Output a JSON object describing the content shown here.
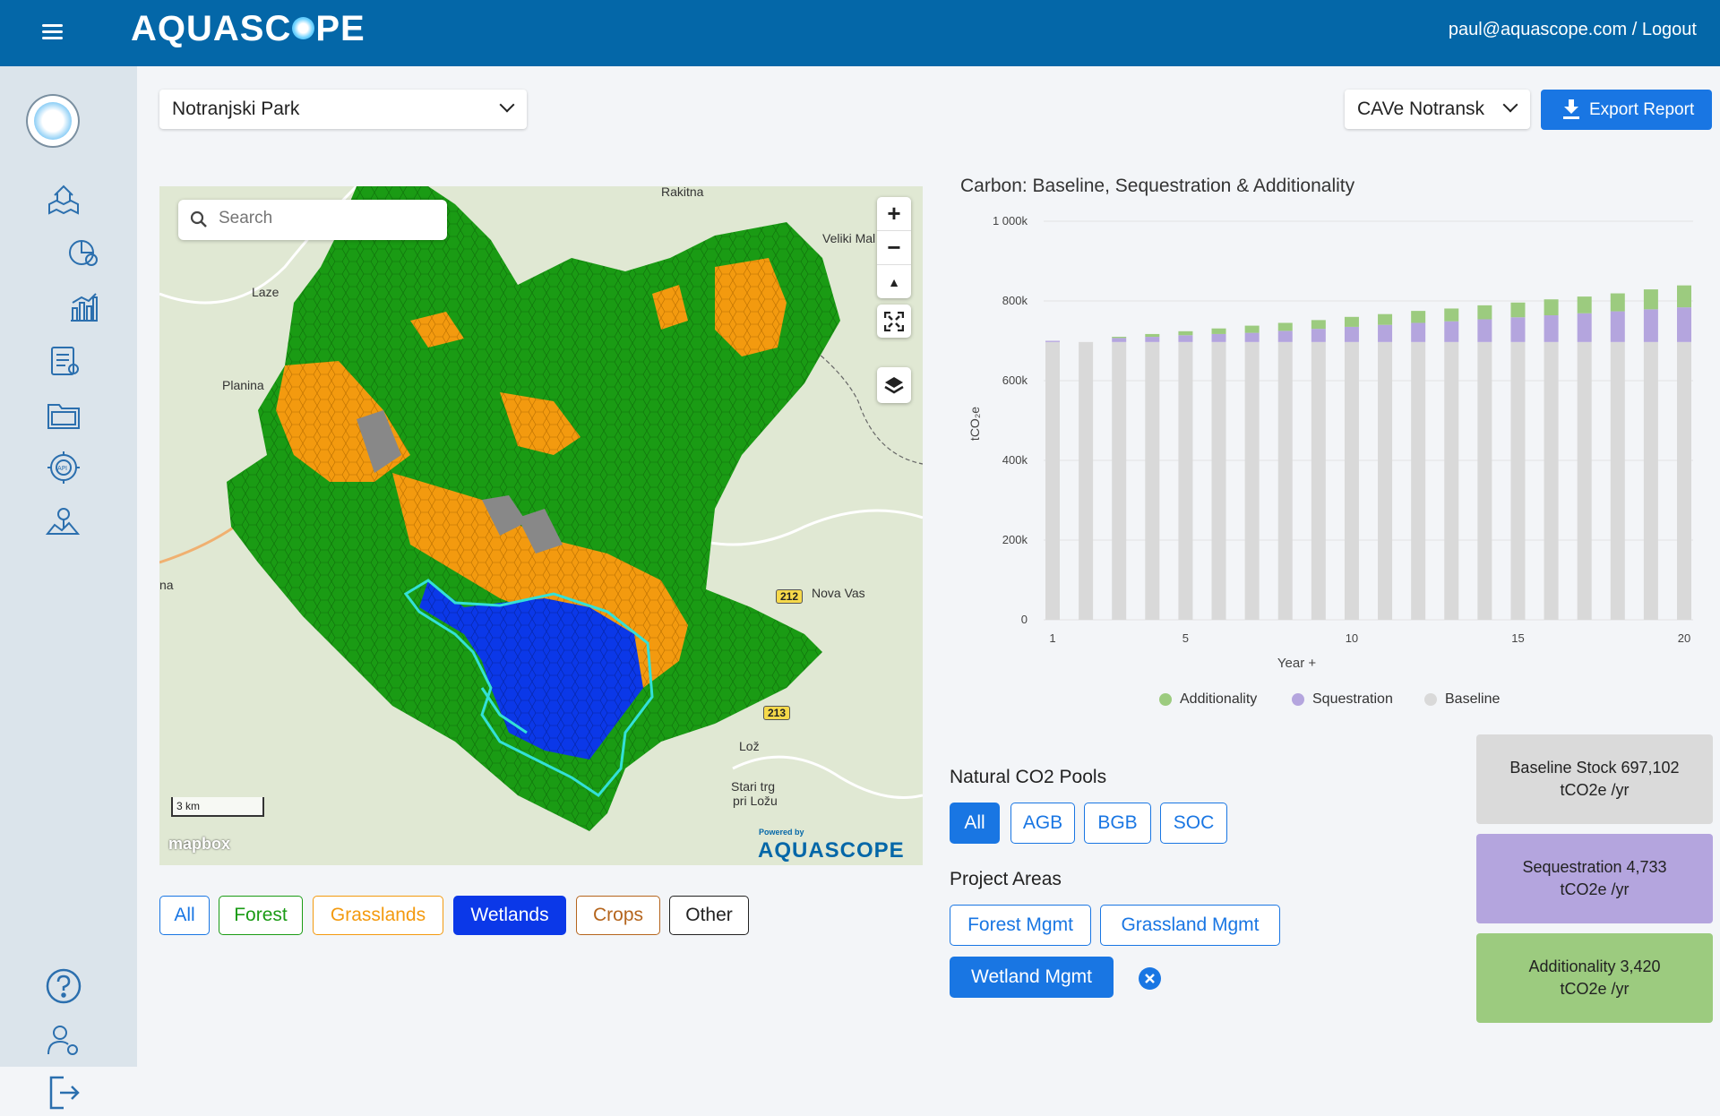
{
  "app": {
    "title": "AQUASCOPE",
    "user": "paul@aquascope.com / Logout"
  },
  "colors": {
    "header": "#0467a8",
    "accent": "#1976e3",
    "forest": "#1a9b14",
    "grassland": "#f39a0f",
    "wetland": "#0b38e8",
    "other": "#888888",
    "baseline": "#d9d9d9",
    "sequestration": "#b4a5de",
    "additionality": "#9ccb7f"
  },
  "sidebar": {
    "icons": [
      "avatar",
      "project-map-icon",
      "pie-chart-icon",
      "bar-chart-icon",
      "clipboard-icon",
      "folder-icon",
      "api-gear-icon",
      "map-pin-icon",
      "help-icon",
      "user-settings-icon",
      "logout-icon"
    ]
  },
  "toolbar": {
    "park_select": "Notranjski Park",
    "cave_select": "CAVe Notransk",
    "export_label": "Export Report"
  },
  "map": {
    "search_placeholder": "Search",
    "scale_label": "3 km",
    "attribution": "mapbox",
    "powered_by": "Powered by",
    "brand": "AQUASCOPE",
    "places": [
      "Rakitna",
      "Veliki Mal",
      "Laze",
      "Planina",
      "na",
      "Nova Vas",
      "Lož",
      "Stari trg",
      "pri Ložu"
    ],
    "roads": [
      "212",
      "213"
    ]
  },
  "filters": [
    "All",
    "Forest",
    "Grasslands",
    "Wetlands",
    "Crops",
    "Other"
  ],
  "active_filter": "Wetlands",
  "chart": {
    "title": "Carbon: Baseline, Sequestration & Additionality",
    "ylabel": "tCO₂e",
    "xlabel": "Year +",
    "yticks": [
      "1 000k",
      "800k",
      "600k",
      "400k",
      "200k",
      "0"
    ],
    "xticks": [
      "1",
      "5",
      "10",
      "15",
      "20"
    ],
    "legend": [
      "Additionality",
      "Squestration",
      "Baseline"
    ]
  },
  "chart_data": {
    "type": "bar",
    "stacked": true,
    "title": "Carbon: Baseline, Sequestration & Additionality",
    "xlabel": "Year +",
    "ylabel": "tCO2e",
    "ylim": [
      0,
      1000000
    ],
    "categories": [
      1,
      2,
      3,
      4,
      5,
      6,
      7,
      8,
      9,
      10,
      11,
      12,
      13,
      14,
      15,
      16,
      17,
      18,
      19,
      20
    ],
    "series": [
      {
        "name": "Baseline",
        "values": [
          697000,
          697000,
          697000,
          697000,
          697000,
          697000,
          697000,
          697000,
          697000,
          697000,
          697000,
          697000,
          697000,
          697000,
          697000,
          697000,
          697000,
          697000,
          697000,
          697000
        ]
      },
      {
        "name": "Squestration",
        "values": [
          3000,
          0,
          10000,
          13000,
          17000,
          20000,
          23000,
          28000,
          33000,
          38000,
          43000,
          48000,
          52000,
          57000,
          62000,
          67000,
          72000,
          77000,
          82000,
          87000
        ]
      },
      {
        "name": "Additionality",
        "values": [
          0,
          0,
          3000,
          7000,
          10000,
          14000,
          18000,
          20000,
          22000,
          25000,
          27000,
          30000,
          32000,
          35000,
          37000,
          40000,
          42000,
          45000,
          50000,
          55000
        ]
      }
    ],
    "legend_position": "bottom"
  },
  "pools": {
    "title": "Natural CO2 Pools",
    "items": [
      "All",
      "AGB",
      "BGB",
      "SOC"
    ],
    "active": "All"
  },
  "projects": {
    "title": "Project Areas",
    "items": [
      "Forest Mgmt",
      "Grassland Mgmt",
      "Wetland Mgmt"
    ],
    "active": "Wetland Mgmt"
  },
  "stats": [
    {
      "label": "Baseline Stock 697,102 tCO2e /yr",
      "color": "#dadada"
    },
    {
      "label": "Sequestration 4,733 tCO2e /yr",
      "color": "#b4a5de"
    },
    {
      "label": "Additionality 3,420 tCO2e /yr",
      "color": "#9ccb7f"
    }
  ]
}
